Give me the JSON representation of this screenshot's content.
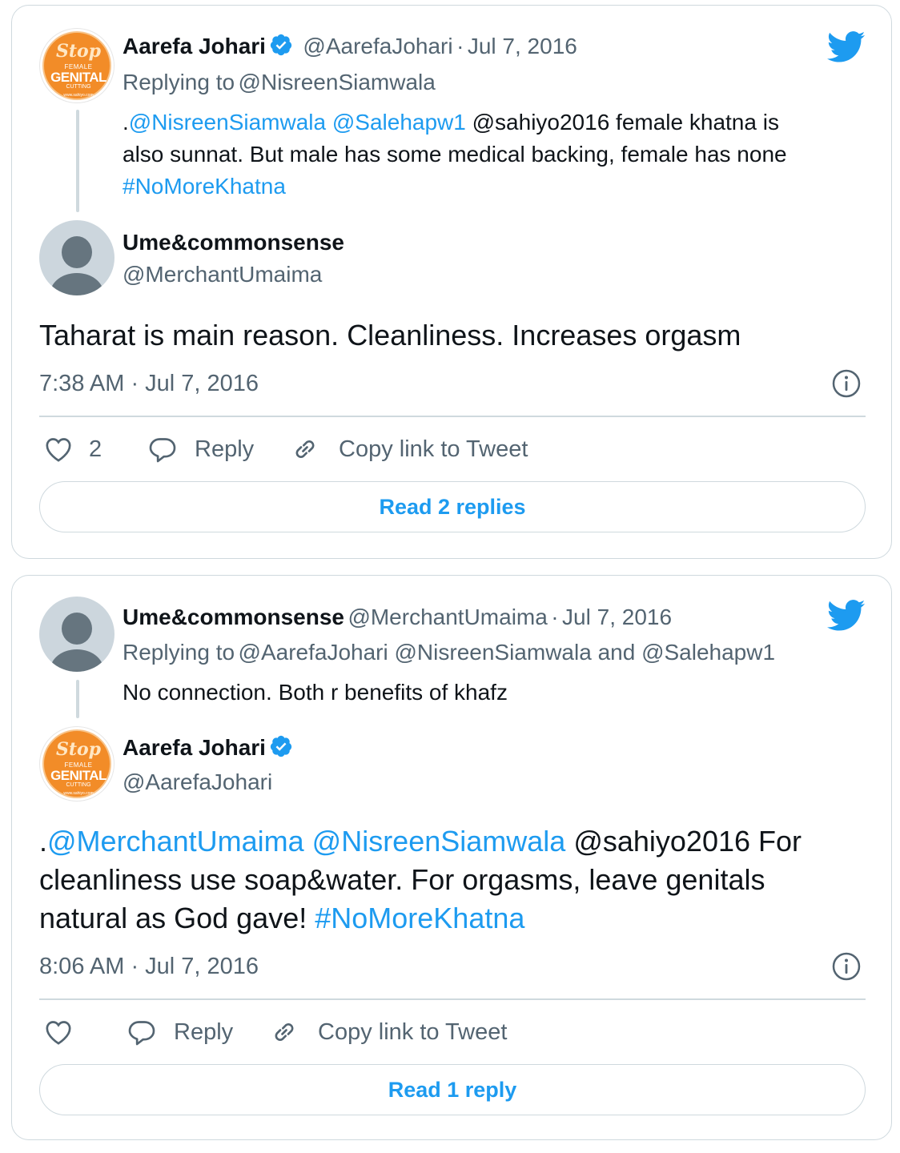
{
  "card1": {
    "parent": {
      "author_name": "Aarefa Johari",
      "author_handle": "@AarefaJohari",
      "separator": "·",
      "date": "Jul 7, 2016",
      "replying_prefix": "Replying to",
      "replying_to": "@NisreenSiamwala",
      "text_dot": ".",
      "mention_1": "@NisreenSiamwala",
      "mention_2": "@Salehapw1",
      "text_line1_rest": "@sahiyo2016 female khatna is",
      "text_line2": "also sunnat. But male has some medical backing, female has none",
      "hashtag": "#NoMoreKhatna"
    },
    "main": {
      "author_name": "Ume&commonsense",
      "author_handle": "@MerchantUmaima",
      "text": "Taharat is main reason. Cleanliness. Increases orgasm",
      "timestamp": "7:38 AM · Jul 7, 2016"
    },
    "actions": {
      "like_count": "2",
      "reply_label": "Reply",
      "copy_label": "Copy link to Tweet"
    },
    "read_replies": "Read 2 replies"
  },
  "card2": {
    "parent": {
      "author_name": "Ume&commonsense",
      "author_handle": "@MerchantUmaima",
      "separator": "·",
      "date": "Jul 7, 2016",
      "replying_prefix": "Replying to",
      "replying_to": "@AarefaJohari @NisreenSiamwala and @Salehapw1",
      "text": "No connection. Both r benefits of khafz"
    },
    "main": {
      "author_name": "Aarefa Johari",
      "author_handle": "@AarefaJohari",
      "text_dot": ".",
      "mention_1": "@MerchantUmaima",
      "mention_2": "@NisreenSiamwala",
      "text_line1_rest": "@sahiyo2016 For",
      "text_line2": "cleanliness use soap&water. For orgasms, leave genitals",
      "text_line3": "natural as God gave!",
      "hashtag": "#NoMoreKhatna",
      "timestamp": "8:06 AM · Jul 7, 2016"
    },
    "actions": {
      "reply_label": "Reply",
      "copy_label": "Copy link to Tweet"
    },
    "read_replies": "Read 1 reply"
  },
  "avatar_logo": {
    "word_stop": "Stop",
    "word_female": "FEMALE",
    "word_genital": "GENITAL",
    "word_cutting": "CUTTING",
    "site": "www.sahiyo.com"
  },
  "colors": {
    "accent": "#1d9bf0",
    "text": "#0f1419",
    "muted": "#536471",
    "border": "#cfd9de",
    "avatar_orange": "#f28c28"
  },
  "icons": [
    "twitter-bird-icon",
    "verified-badge-icon",
    "info-icon",
    "heart-icon",
    "reply-bubble-icon",
    "link-icon"
  ]
}
